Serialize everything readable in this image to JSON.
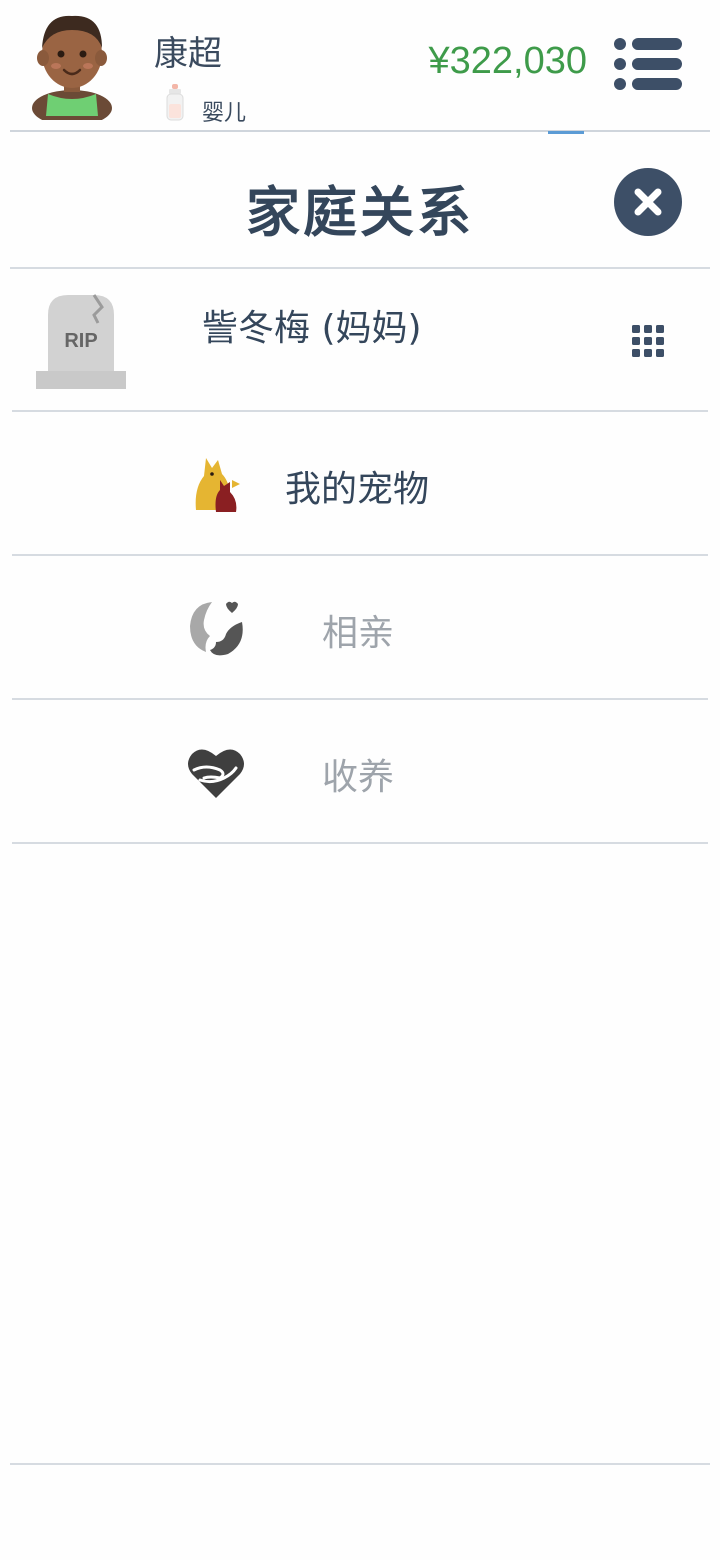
{
  "profile": {
    "name": "康超",
    "life_stage": "婴儿",
    "money": "¥322,030"
  },
  "panel": {
    "title": "家庭关系"
  },
  "relations": [
    {
      "name": "訾冬梅 (妈妈)",
      "status": "deceased",
      "icon": "tombstone-rip-icon",
      "icon_text": "RIP"
    },
    {
      "label": "我的宠物",
      "icon": "pet-dog-cat-icon",
      "enabled": true
    },
    {
      "label": "相亲",
      "icon": "blind-date-faces-icon",
      "enabled": false
    },
    {
      "label": "收养",
      "icon": "adopt-heart-hands-icon",
      "enabled": false
    }
  ],
  "colors": {
    "money": "#3e9b4a",
    "primary_text": "#34465b",
    "muted_text": "#9ea4ab",
    "close_button_bg": "#3d4f67"
  }
}
